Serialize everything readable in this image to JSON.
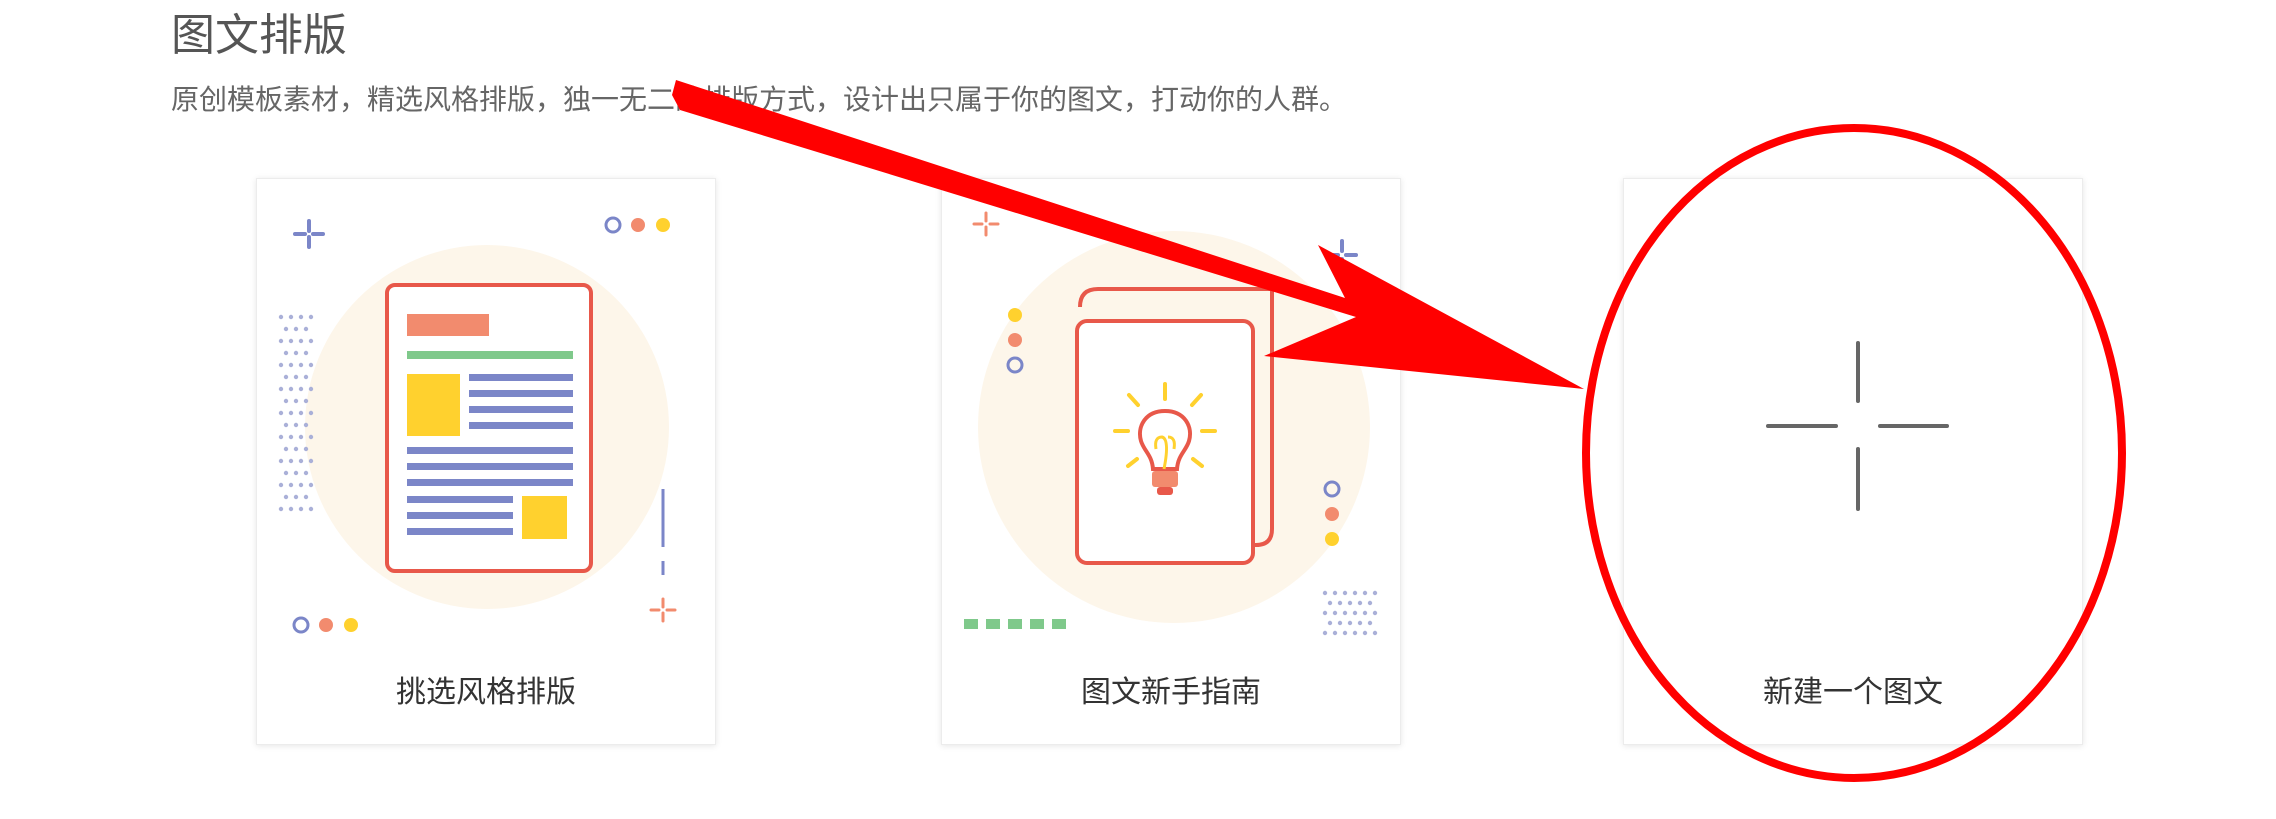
{
  "header": {
    "title": "图文排版",
    "subtitle": "原创模板素材，精选风格排版，独一无二的排版方式，设计出只属于你的图文，打动你的人群。"
  },
  "cards": [
    {
      "label": "挑选风格排版",
      "icon": "document-template-icon"
    },
    {
      "label": "图文新手指南",
      "icon": "lightbulb-book-icon"
    },
    {
      "label": "新建一个图文",
      "icon": "plus-icon"
    }
  ],
  "colors": {
    "salmon": "#f28b6e",
    "outline": "#e8584a",
    "green": "#7fc98b",
    "blue": "#7b86c8",
    "yellow": "#ffd12e",
    "cream": "#fdf6ea",
    "annotation_red": "#ff0000"
  }
}
